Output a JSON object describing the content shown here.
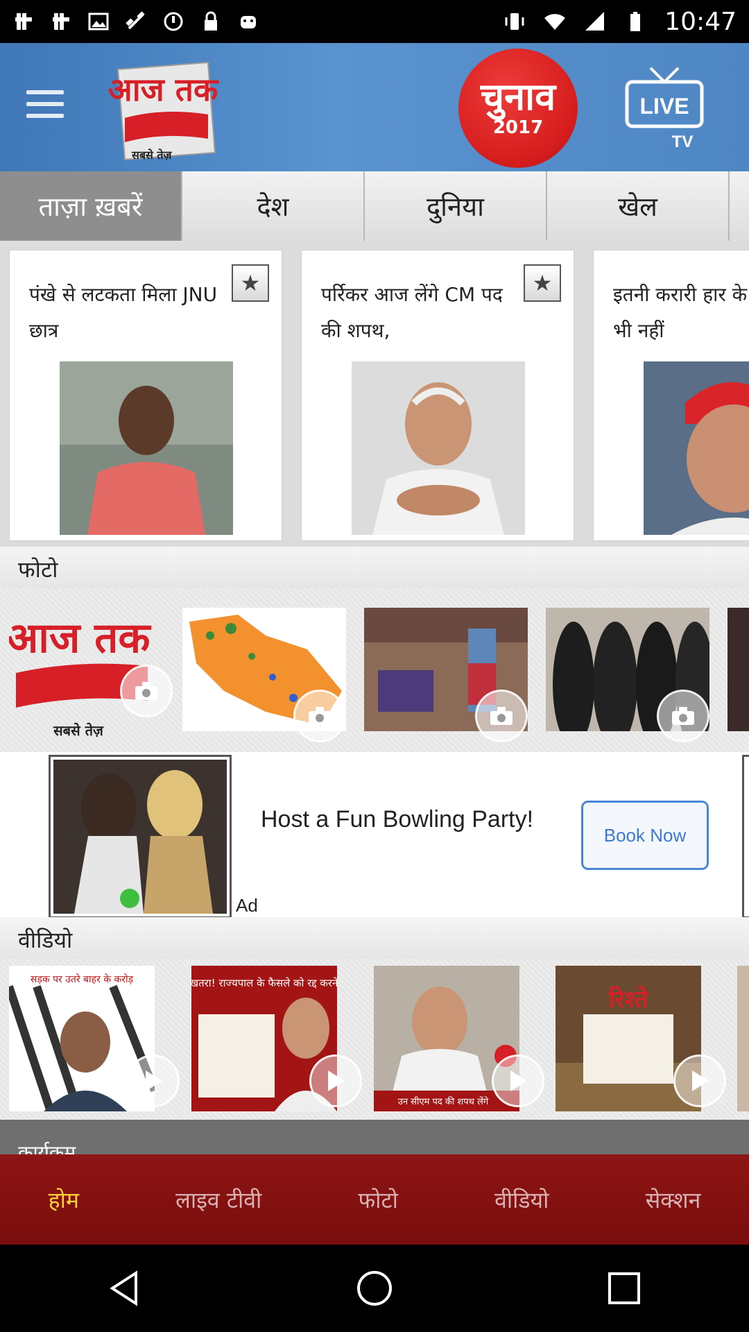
{
  "status_bar": {
    "time": "10:47",
    "left_icons": [
      "notification-icon",
      "notification-icon",
      "image-icon",
      "dots-icon",
      "satellite-icon",
      "cast-icon",
      "sync-icon",
      "lock-icon",
      "android-icon"
    ],
    "right_icons": [
      "vibrate-icon",
      "wifi-icon",
      "signal-icon",
      "battery-icon"
    ]
  },
  "header": {
    "logo_text": "आज तक",
    "logo_tagline": "सबसे तेज़",
    "chunav_title": "चुनाव",
    "chunav_year": "2017",
    "live_label": "LIVE",
    "tv_label": "TV"
  },
  "tabs": [
    {
      "label": "ताज़ा ख़बरें",
      "active": true
    },
    {
      "label": "देश",
      "active": false
    },
    {
      "label": "दुनिया",
      "active": false
    },
    {
      "label": "खेल",
      "active": false
    }
  ],
  "news_cards": [
    {
      "title": "पंखे से लटकता मिला JNU छात्र"
    },
    {
      "title": "पर्रिकर आज लेंगे CM पद की शपथ,"
    },
    {
      "title": "इतनी करारी हार के बावजूद भी नहीं"
    }
  ],
  "photos_section": {
    "header": "फोटो",
    "thumbs": [
      "aajtak-logo",
      "up-map",
      "village-women",
      "women-in-burqa"
    ]
  },
  "ad": {
    "title": "Host a Fun Bowling Party!",
    "button": "Book Now",
    "label": "Ad"
  },
  "videos_section": {
    "header": "वीडियो",
    "thumbs": [
      {
        "caption": "सड़क पर उतरे बाहर के करोड़"
      },
      {
        "caption": "पर्रिकर की ताजपोशी पर खतरा! राज्यपाल के फैसले को रद्द करने की मांग"
      },
      {
        "caption": "उन सीएम पद की शपथ लेंगे"
      },
      {
        "caption": "रिश्ते"
      }
    ]
  },
  "more_section": {
    "label": "कार्यक्रम"
  },
  "bottom_nav": [
    {
      "label": "होम",
      "active": true
    },
    {
      "label": "लाइव टीवी",
      "active": false
    },
    {
      "label": "फोटो",
      "active": false
    },
    {
      "label": "वीडियो",
      "active": false
    },
    {
      "label": "सेक्शन",
      "active": false
    }
  ],
  "colors": {
    "header_blue": "#4f86c4",
    "chunav_red": "#d41c1c",
    "nav_red": "#8e1414",
    "nav_active": "#ffd23c",
    "book_button": "#3d79cf"
  }
}
